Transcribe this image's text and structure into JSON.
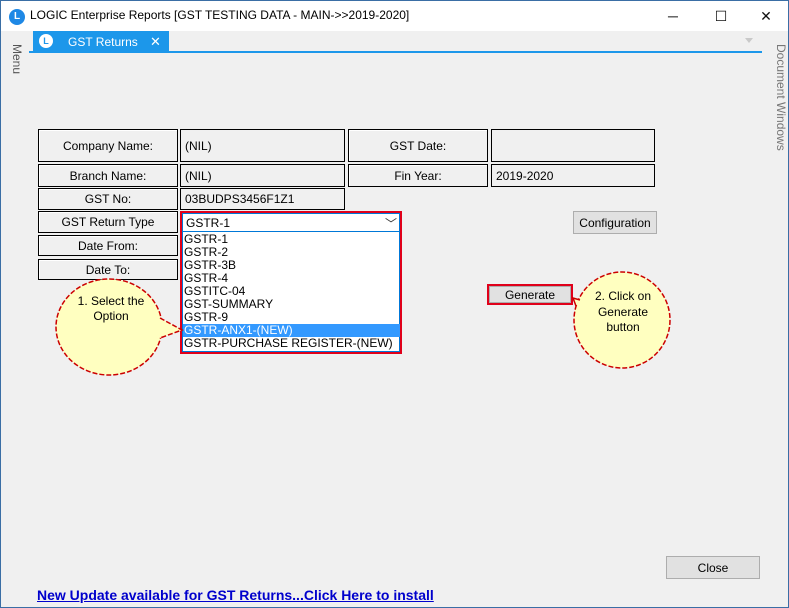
{
  "window": {
    "title": "LOGIC Enterprise Reports  [GST TESTING DATA - MAIN->>2019-2020]",
    "app_icon": "L",
    "controls": {
      "minimize": "─",
      "maximize": "☐",
      "close": "✕"
    }
  },
  "side_panels": {
    "left": "Menu",
    "right": "Document Windows"
  },
  "tab": {
    "label": "GST Returns",
    "close": "✕",
    "icon": "L"
  },
  "form": {
    "company_name_label": "Company Name:",
    "company_name_value": "(NIL)",
    "gst_date_label": "GST Date:",
    "gst_date_value": "",
    "branch_name_label": "Branch Name:",
    "branch_name_value": "(NIL)",
    "fin_year_label": "Fin Year:",
    "fin_year_value": "2019-2020",
    "gst_no_label": "GST No:",
    "gst_no_value": "03BUDPS3456F1Z1",
    "gst_return_type_label": "GST Return Type",
    "gst_return_type_value": "GSTR-1",
    "date_from_label": "Date From:",
    "date_to_label": "Date To:"
  },
  "dropdown_options": [
    "GSTR-1",
    "GSTR-2",
    "GSTR-3B",
    "GSTR-4",
    "GSTITC-04",
    "GST-SUMMARY",
    "GSTR-9",
    "GSTR-ANX1-(NEW)",
    "GSTR-PURCHASE REGISTER-(NEW)"
  ],
  "selected_option_index": 7,
  "buttons": {
    "configuration": "Configuration",
    "generate": "Generate",
    "close": "Close"
  },
  "callouts": {
    "one": [
      "1.  Select   the",
      "Option"
    ],
    "two": [
      "2.  Click    on",
      "Generate",
      "button"
    ]
  },
  "footer_link": "New Update available for GST Returns...Click Here to install",
  "colors": {
    "accent": "#1c97ea",
    "highlight": "#e0001a",
    "callout_fill": "#ffffc0",
    "callout_border": "#cc0000",
    "selection": "#3399ff",
    "link": "#0000cc"
  }
}
